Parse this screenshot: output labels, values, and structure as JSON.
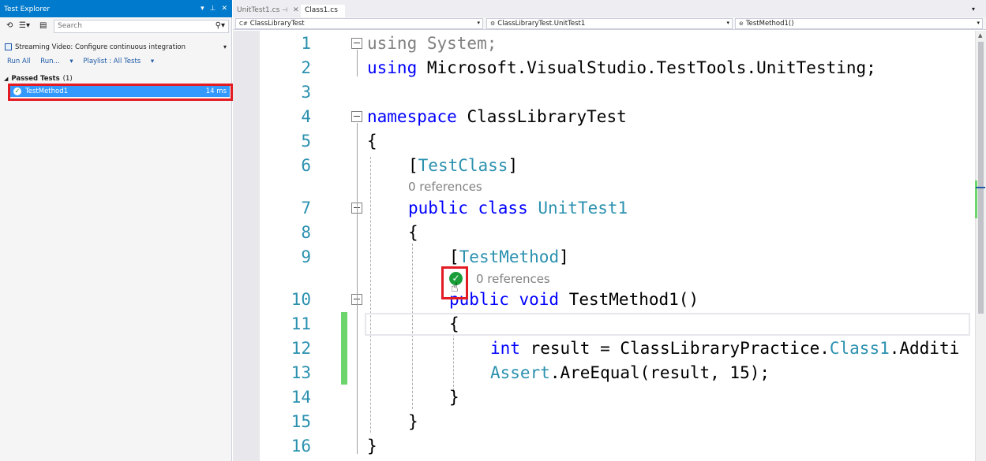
{
  "test_explorer": {
    "title": "Test Explorer",
    "search_placeholder": "Search",
    "streaming_video": "Streaming Video: Configure continuous integration",
    "actions": {
      "run_all": "Run All",
      "run": "Run...",
      "playlist": "Playlist : All Tests"
    },
    "group": {
      "label": "Passed Tests",
      "count": "(1)"
    },
    "tests": [
      {
        "name": "TestMethod1",
        "duration": "14 ms",
        "status": "passed"
      }
    ]
  },
  "tabs": [
    {
      "label": "UnitTest1.cs",
      "active": false
    },
    {
      "label": "Class1.cs",
      "active": true
    }
  ],
  "navbar": {
    "project": "ClassLibraryTest",
    "type": "ClassLibraryTest.UnitTest1",
    "member": "TestMethod1()"
  },
  "editor": {
    "line_numbers": [
      "1",
      "2",
      "3",
      "4",
      "5",
      "6",
      "7",
      "8",
      "9",
      "10",
      "11",
      "12",
      "13",
      "14",
      "15",
      "16"
    ],
    "lens_references": "0 references",
    "lines": {
      "l1_kw": "using",
      "l1_rest": " System;",
      "l2_kw": "using",
      "l2_rest": " Microsoft.VisualStudio.TestTools.UnitTesting;",
      "l4_kw": "namespace",
      "l4_rest": " ClassLibraryTest",
      "open_brace": "{",
      "close_brace": "}",
      "l6_open": "[",
      "l6_attr": "TestClass",
      "l6_close": "]",
      "l7_kw": "public class",
      "l7_type": "UnitTest1",
      "l9_open": "[",
      "l9_attr": "TestMethod",
      "l9_close": "]",
      "l10_kw": "public void",
      "l10_rest": " TestMethod1()",
      "l12_kw": "int",
      "l12_mid": " result = ClassLibraryPractice.",
      "l12_type": "Class1",
      "l12_rest": ".Additi",
      "l13_type": "Assert",
      "l13_rest": ".AreEqual(result, 15);"
    }
  },
  "colors": {
    "accent": "#007acc",
    "selection": "#3399ff",
    "keyword": "#0000ff",
    "type": "#2b91af",
    "highlight": "#e31c23",
    "pass": "#1b9e3a"
  }
}
